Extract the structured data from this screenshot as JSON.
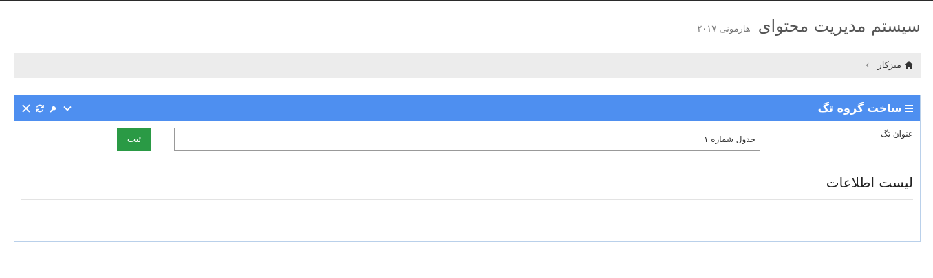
{
  "header": {
    "title": "سیستم مدیریت محتوای",
    "subtitle": "هارمونی ۲۰۱۷"
  },
  "breadcrumb": {
    "items": [
      {
        "label": "میزکار",
        "icon": "home-icon"
      }
    ],
    "separator": "›"
  },
  "panel": {
    "title": "ساخت گروه تگ",
    "title_icon": "bars-icon",
    "heading_color": "#4e8ff0",
    "tools": [
      "chevron-down-icon",
      "wrench-icon",
      "refresh-icon",
      "close-icon"
    ],
    "form": {
      "tag_title_label": "عنوان تگ",
      "tag_title_value": "جدول شماره ۱",
      "submit_label": "ثبت",
      "submit_color": "#2a9a45"
    },
    "list_heading": "لیست اطلاعات"
  }
}
